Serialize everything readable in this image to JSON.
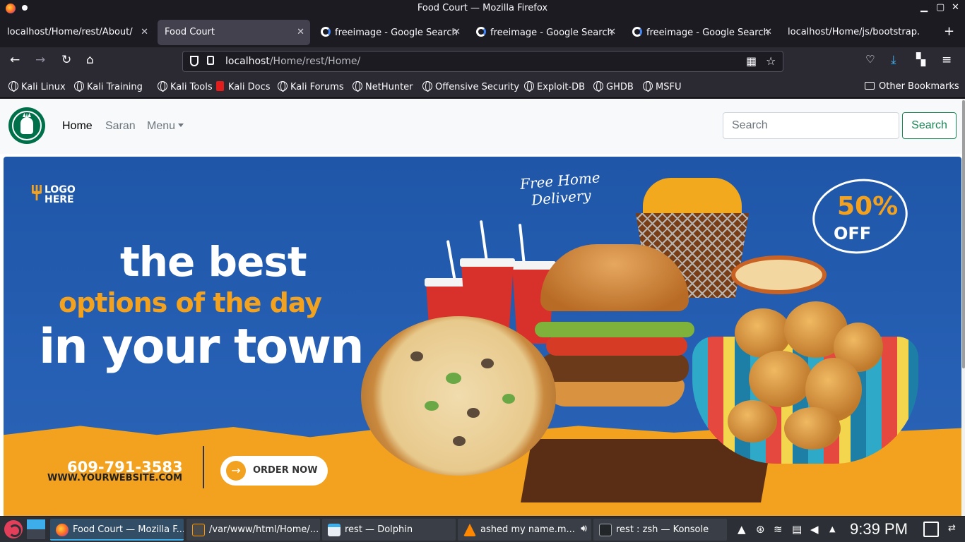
{
  "window": {
    "title": "Food Court — Mozilla Firefox"
  },
  "tabs": [
    {
      "label": "localhost/Home/rest/About/",
      "active": false
    },
    {
      "label": "Food Court",
      "active": true
    },
    {
      "label": "freeimage - Google Search",
      "active": false
    },
    {
      "label": "freeimage - Google Search",
      "active": false
    },
    {
      "label": "freeimage - Google Search",
      "active": false
    },
    {
      "label": "localhost/Home/js/bootstrap.",
      "active": false
    }
  ],
  "urlbar": {
    "host": "localhost",
    "path": "/Home/rest/Home/"
  },
  "bookmarks": [
    {
      "label": "Kali Linux",
      "icon": "globe-icon"
    },
    {
      "label": "Kali Training",
      "icon": "globe-icon"
    },
    {
      "label": "Kali Tools",
      "icon": "globe-icon"
    },
    {
      "label": "Kali Docs",
      "icon": "kali-docs-icon"
    },
    {
      "label": "Kali Forums",
      "icon": "globe-icon"
    },
    {
      "label": "NetHunter",
      "icon": "globe-icon"
    },
    {
      "label": "Offensive Security",
      "icon": "globe-icon"
    },
    {
      "label": "Exploit-DB",
      "icon": "globe-icon"
    },
    {
      "label": "GHDB",
      "icon": "globe-icon"
    },
    {
      "label": "MSFU",
      "icon": "globe-icon"
    }
  ],
  "other_bookmarks": "Other Bookmarks",
  "site": {
    "nav": {
      "home": "Home",
      "saran": "Saran",
      "menu": "Menu"
    },
    "search": {
      "placeholder": "Search",
      "button": "Search"
    },
    "banner": {
      "logo_line1": "LOGO",
      "logo_line2": "HERE",
      "headline1": "the best",
      "headline2": "options of the day",
      "headline3": "in your town",
      "delivery_line1": "Free Home",
      "delivery_line2": "Delivery",
      "discount_pct": "50%",
      "discount_off": "OFF",
      "phone": "609-791-3583",
      "website": "WWW.YOURWEBSITE.COM",
      "order_button": "ORDER NOW"
    }
  },
  "taskbar": {
    "items": [
      {
        "label": "Food Court — Mozilla F...",
        "active": true,
        "icon": "firefox-icon"
      },
      {
        "label": "/var/www/html/Home/...",
        "active": false,
        "icon": "sublime-icon"
      },
      {
        "label": "rest — Dolphin",
        "active": false,
        "icon": "dolphin-icon"
      },
      {
        "label": "ashed my name.m...",
        "active": false,
        "icon": "vlc-icon"
      },
      {
        "label": "rest : zsh — Konsole",
        "active": false,
        "icon": "konsole-icon"
      }
    ],
    "clock": "9:39 PM"
  },
  "colors": {
    "accent_green": "#198754",
    "banner_blue": "#1f56a8",
    "banner_orange": "#f2a21f",
    "starbucks_green": "#00704a"
  }
}
